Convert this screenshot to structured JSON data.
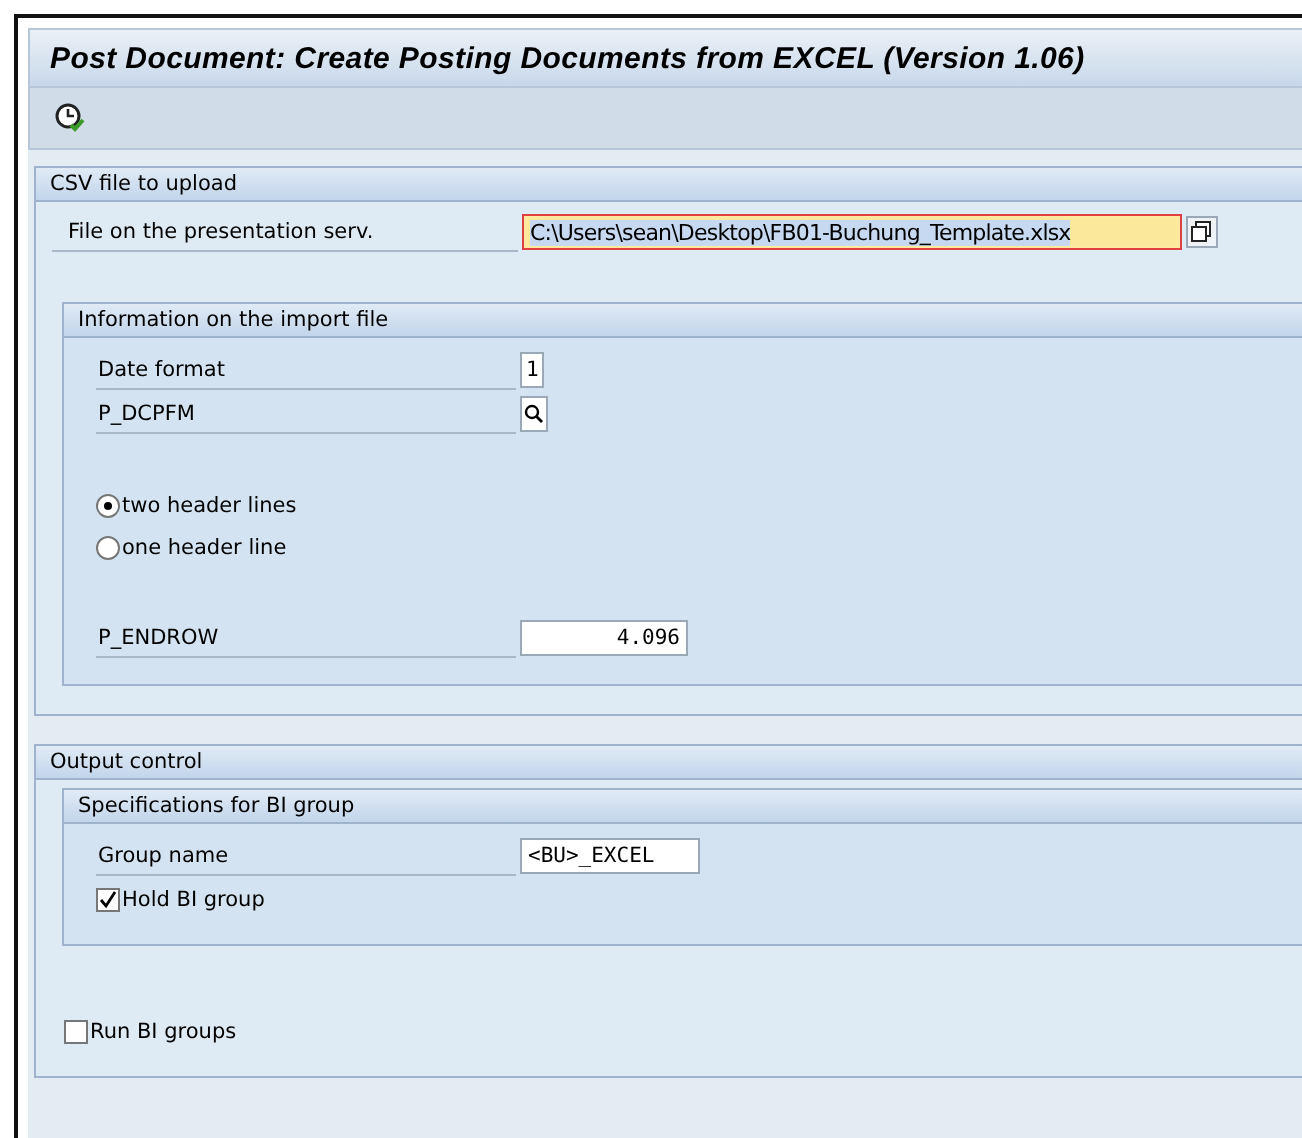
{
  "window": {
    "title": "Post Document: Create Posting Documents from EXCEL (Version 1.06)"
  },
  "sections": [
    {
      "title": "CSV file to upload",
      "blocks": [
        [
          {
            "kind": "path-field",
            "label": "File on the presentation serv.",
            "value": "C:\\Users\\sean\\Desktop\\FB01-Buchung_Template.xlsx",
            "focused": true
          }
        ]
      ],
      "subgroups": [
        {
          "title": "Information on the import file",
          "blocks": [
            [
              {
                "kind": "char-field",
                "label": "Date format",
                "value": "1",
                "focused": false
              },
              {
                "kind": "search-field",
                "label": "P_DCPFM",
                "focused": false
              }
            ],
            [
              {
                "kind": "radio",
                "label": "two header lines",
                "selected": true
              },
              {
                "kind": "radio",
                "label": "one header line",
                "selected": false
              }
            ],
            [
              {
                "kind": "number-field",
                "label": "P_ENDROW",
                "value": "4.096",
                "focused": false
              }
            ]
          ]
        }
      ]
    },
    {
      "title": "Output control",
      "subgroups": [
        {
          "title": "Specifications for BI group",
          "blocks": [
            [
              {
                "kind": "text-field",
                "label": "Group name",
                "value": "<BU>_EXCEL",
                "focused": false
              },
              {
                "kind": "checkbox",
                "label": "Hold BI group",
                "checked": true
              }
            ]
          ]
        }
      ],
      "after": [
        {
          "kind": "checkbox",
          "label": "Run BI groups",
          "checked": false
        }
      ]
    }
  ]
}
